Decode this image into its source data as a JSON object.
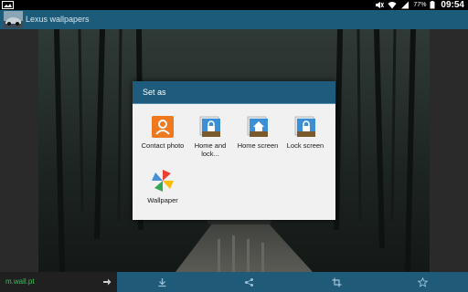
{
  "status_bar": {
    "battery_percent": "77%",
    "time": "09:54",
    "icons": [
      "image-notification-icon",
      "mute-icon",
      "wifi-icon",
      "signal-icon",
      "battery-icon"
    ]
  },
  "action_bar": {
    "title": "Lexus wallpapers",
    "icon": "lexus-car-thumbnail-icon"
  },
  "dialog": {
    "title": "Set as",
    "options": [
      {
        "label": "Contact photo",
        "icon": "contact-photo-icon",
        "color": "#f0781e"
      },
      {
        "label": "Home and lock...",
        "icon": "home-and-lock-icon",
        "color": "#3c8fd4"
      },
      {
        "label": "Home screen",
        "icon": "home-screen-icon",
        "color": "#3c8fd4"
      },
      {
        "label": "Lock screen",
        "icon": "lock-screen-icon",
        "color": "#3c8fd4"
      },
      {
        "label": "Wallpaper",
        "icon": "wallpaper-pinwheel-icon",
        "color": "#4a90d9"
      }
    ]
  },
  "bottom_bar": {
    "ad_text": "m.wall.pt",
    "icons": [
      "ad-arrow-icon",
      "download-icon",
      "share-icon",
      "crop-icon",
      "favorite-star-icon"
    ]
  },
  "colors": {
    "action_bar": "#1d5b7a",
    "dialog_header": "#1e5b7c",
    "dialog_body": "#f1f1f1",
    "ad_text": "#2ec64f"
  }
}
